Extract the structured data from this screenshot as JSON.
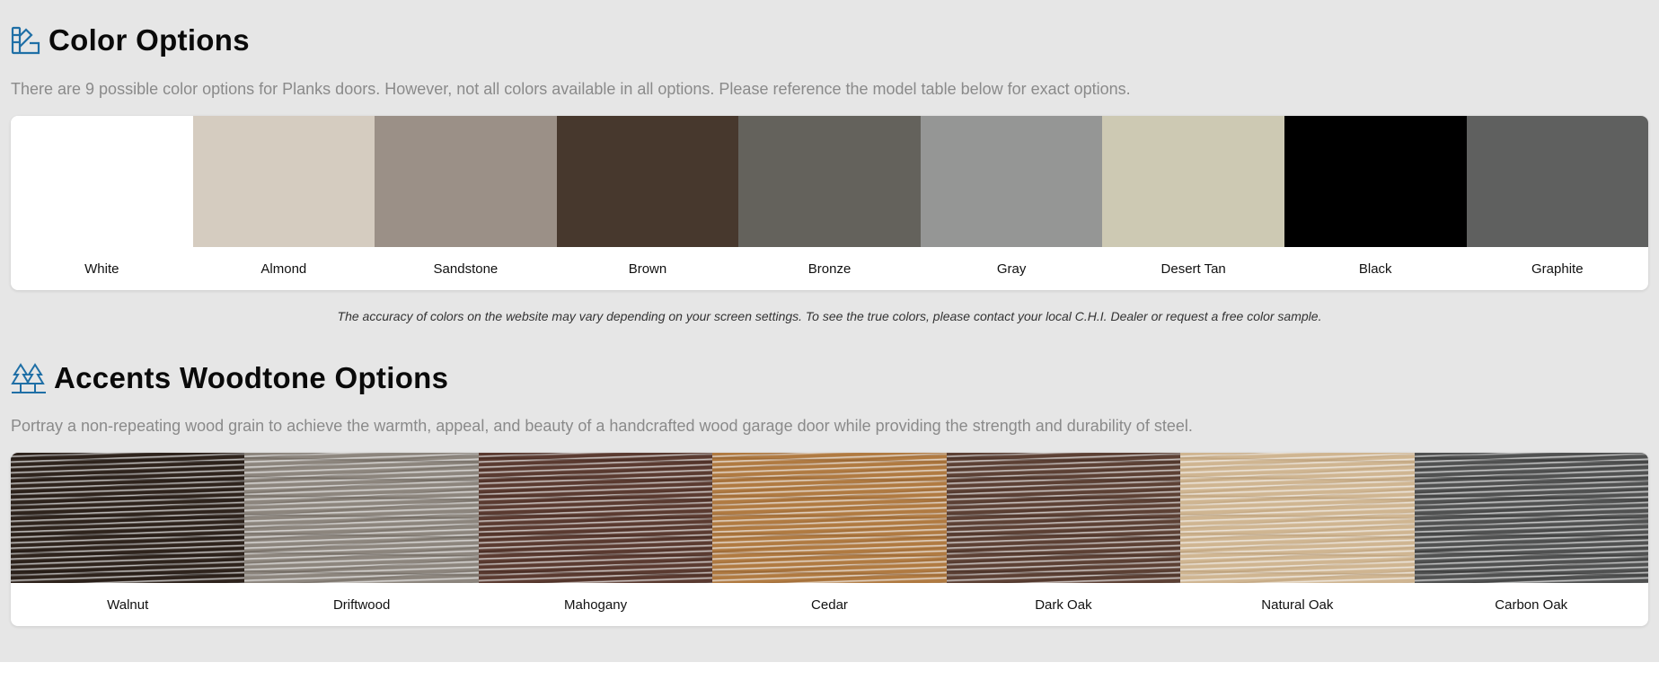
{
  "color_section": {
    "title": "Color Options",
    "icon": "swatch-palette-icon",
    "intro": "There are 9 possible color options for Planks doors. However, not all colors available in all options. Please reference the model table below for exact options.",
    "colors": [
      {
        "label": "White",
        "hex": "#ffffff"
      },
      {
        "label": "Almond",
        "hex": "#d5ccc0"
      },
      {
        "label": "Sandstone",
        "hex": "#9b9087"
      },
      {
        "label": "Brown",
        "hex": "#47382d"
      },
      {
        "label": "Bronze",
        "hex": "#64625c"
      },
      {
        "label": "Gray",
        "hex": "#959695"
      },
      {
        "label": "Desert Tan",
        "hex": "#cdc9b3"
      },
      {
        "label": "Black",
        "hex": "#000000"
      },
      {
        "label": "Graphite",
        "hex": "#5f605f"
      }
    ],
    "disclaimer": "The accuracy of colors on the website may vary depending on your screen settings. To see the true colors, please contact your local C.H.I. Dealer or request a free color sample."
  },
  "woodtone_section": {
    "title": "Accents Woodtone Options",
    "icon": "trees-icon",
    "intro": "Portray a non-repeating wood grain to achieve the warmth, appeal, and beauty of a handcrafted wood garage door while providing the strength and durability of steel.",
    "woods": [
      {
        "label": "Walnut",
        "base": "#2e231c",
        "grain": "#1a130f"
      },
      {
        "label": "Driftwood",
        "base": "#8c857d",
        "grain": "#5e574f"
      },
      {
        "label": "Mahogany",
        "base": "#5a3a30",
        "grain": "#3a2119"
      },
      {
        "label": "Cedar",
        "base": "#b07a41",
        "grain": "#8a5a2b"
      },
      {
        "label": "Dark Oak",
        "base": "#5c4034",
        "grain": "#3b261e"
      },
      {
        "label": "Natural Oak",
        "base": "#cfb591",
        "grain": "#b1946e"
      },
      {
        "label": "Carbon Oak",
        "base": "#505151",
        "grain": "#2c2d2d"
      }
    ]
  }
}
